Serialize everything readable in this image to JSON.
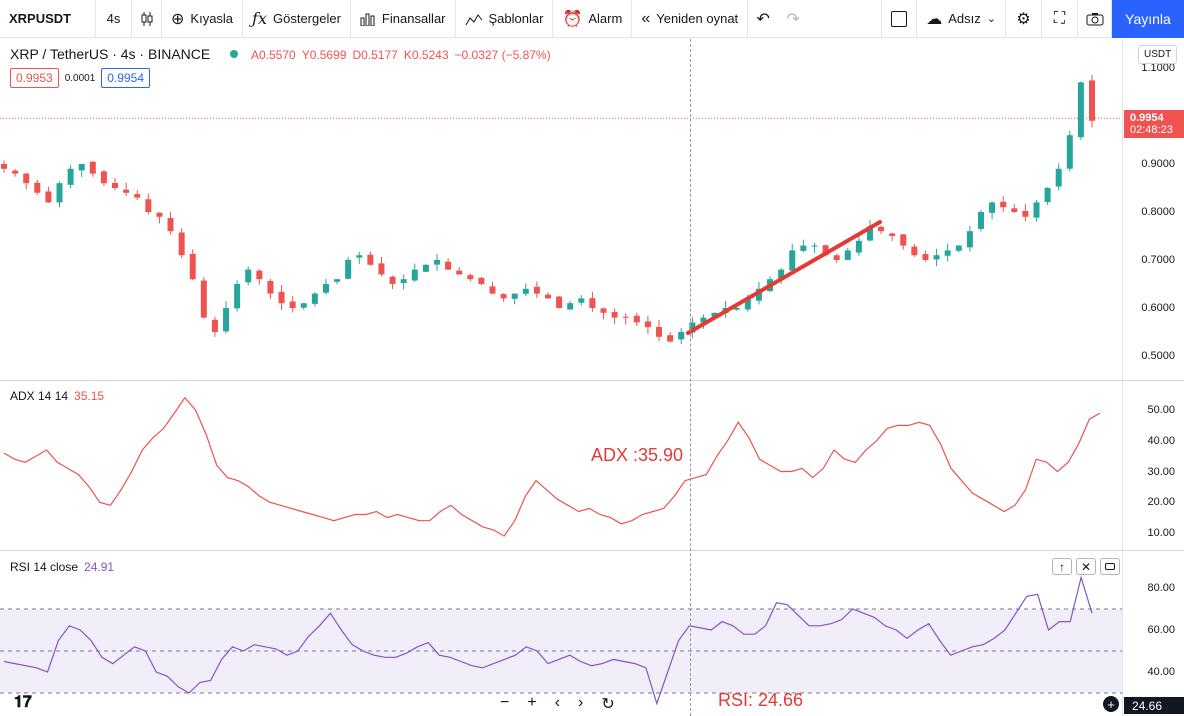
{
  "toolbar": {
    "symbol": "XRPUSDT",
    "interval": "4s",
    "compare": "Kıyasla",
    "indicators": "Göstergeler",
    "financials": "Finansallar",
    "templates": "Şablonlar",
    "alert": "Alarm",
    "replay": "Yeniden oynat",
    "layout_name": "Adsız",
    "publish": "Yayınla",
    "undo_icon": "undo-icon",
    "redo_icon": "redo-icon"
  },
  "header": {
    "title": "XRP / TetherUS · 4s · BINANCE",
    "ohlc": {
      "o": "A0.5570",
      "h": "Y0.5699",
      "l": "D0.5177",
      "c": "K0.5243",
      "chg": "−0.0327 (−5.87%)"
    },
    "bid": "0.9953",
    "spread": "0.0001",
    "ask": "0.9954"
  },
  "axis": {
    "currency": "USDT",
    "price_ticks": [
      "1.1000",
      "0.9000",
      "0.8000",
      "0.7000",
      "0.6000",
      "0.5000"
    ],
    "adx_ticks": [
      "50.00",
      "40.00",
      "30.00",
      "20.00",
      "10.00"
    ],
    "rsi_ticks": [
      "80.00",
      "60.00",
      "40.00"
    ],
    "last_price": "0.9954",
    "countdown": "02:48:23",
    "rsi_last": "24.66"
  },
  "indicators": {
    "adx": {
      "name": "ADX 14 14",
      "value": "35.15"
    },
    "rsi": {
      "name": "RSI 14 close",
      "value": "24.91"
    }
  },
  "annotations": {
    "adx_note": "ADX :35.90",
    "rsi_note": "RSI: 24.66"
  },
  "colors": {
    "up": "#26a69a",
    "down": "#ef5350",
    "adx": "#ef5350",
    "rsi": "#7e57c2",
    "trendline": "#e53935",
    "accent": "#2962ff"
  },
  "chart_data": [
    {
      "type": "candlestick",
      "symbol": "XRP / TetherUS",
      "ylim": [
        0.47,
        1.1
      ],
      "close_approx": [
        0.89,
        0.88,
        0.86,
        0.84,
        0.82,
        0.86,
        0.89,
        0.9,
        0.88,
        0.86,
        0.85,
        0.84,
        0.83,
        0.8,
        0.79,
        0.76,
        0.71,
        0.66,
        0.58,
        0.55,
        0.6,
        0.65,
        0.68,
        0.66,
        0.63,
        0.61,
        0.6,
        0.61,
        0.63,
        0.65,
        0.66,
        0.7,
        0.71,
        0.69,
        0.67,
        0.65,
        0.66,
        0.68,
        0.69,
        0.7,
        0.68,
        0.67,
        0.66,
        0.65,
        0.63,
        0.62,
        0.63,
        0.64,
        0.63,
        0.62,
        0.6,
        0.61,
        0.62,
        0.6,
        0.59,
        0.58,
        0.58,
        0.57,
        0.56,
        0.54,
        0.53,
        0.55,
        0.57,
        0.58,
        0.59,
        0.6,
        0.6,
        0.62,
        0.64,
        0.66,
        0.68,
        0.72,
        0.73,
        0.73,
        0.71,
        0.7,
        0.72,
        0.74,
        0.77,
        0.76,
        0.75,
        0.73,
        0.71,
        0.7,
        0.71,
        0.72,
        0.73,
        0.76,
        0.8,
        0.82,
        0.81,
        0.8,
        0.79,
        0.82,
        0.85,
        0.89,
        0.96,
        1.07,
        0.99
      ]
    },
    {
      "type": "line",
      "name": "ADX 14 14",
      "ylim": [
        5,
        56
      ],
      "values": [
        36,
        34,
        33,
        35,
        37,
        33,
        31,
        29,
        25,
        20,
        19,
        24,
        30,
        37,
        41,
        44,
        49,
        54,
        50,
        42,
        32,
        28,
        27,
        25,
        22,
        20,
        19,
        18,
        17,
        16,
        15,
        14,
        15,
        16,
        16,
        17,
        15,
        16,
        15,
        14,
        14,
        17,
        19,
        16,
        14,
        12,
        11,
        9,
        14,
        22,
        27,
        24,
        21,
        19,
        17,
        18,
        16,
        15,
        13,
        14,
        16,
        17,
        18,
        22,
        27,
        28,
        29,
        35,
        40,
        46,
        41,
        34,
        32,
        30,
        30,
        31,
        28,
        31,
        37,
        34,
        33,
        37,
        40,
        44,
        45,
        45,
        46,
        45,
        39,
        31,
        27,
        23,
        21,
        19,
        17,
        19,
        24,
        34,
        33,
        30,
        33,
        39,
        47,
        49
      ]
    },
    {
      "type": "line",
      "name": "RSI 14 close",
      "ylim": [
        20,
        90
      ],
      "levels": [
        70,
        50,
        30
      ],
      "values": [
        45,
        44,
        43,
        42,
        40,
        55,
        62,
        60,
        55,
        47,
        44,
        48,
        52,
        50,
        40,
        38,
        33,
        30,
        35,
        36,
        46,
        52,
        50,
        53,
        52,
        51,
        48,
        50,
        57,
        62,
        68,
        60,
        53,
        50,
        48,
        47,
        47,
        49,
        52,
        54,
        48,
        47,
        45,
        43,
        42,
        44,
        46,
        48,
        52,
        50,
        44,
        46,
        48,
        45,
        43,
        44,
        46,
        45,
        44,
        42,
        25,
        40,
        55,
        62,
        61,
        60,
        64,
        62,
        58,
        58,
        62,
        73,
        72,
        67,
        62,
        62,
        63,
        65,
        70,
        68,
        66,
        62,
        60,
        56,
        60,
        63,
        55,
        48,
        50,
        52,
        53,
        56,
        60,
        68,
        76,
        77,
        60,
        64,
        64,
        85,
        68
      ]
    }
  ]
}
